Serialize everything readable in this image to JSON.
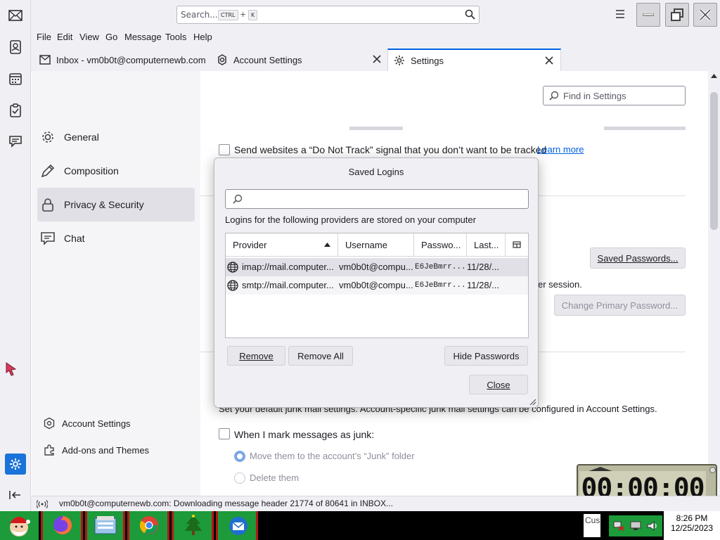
{
  "search": {
    "placeholder": "Search...",
    "key1": "CTRL",
    "plus": "+",
    "key2": "K"
  },
  "menu": [
    "File",
    "Edit",
    "View",
    "Go",
    "Message",
    "Tools",
    "Help"
  ],
  "tabs": [
    {
      "label": "Inbox - vm0b0t@computernewb.com"
    },
    {
      "label": "Account Settings"
    },
    {
      "label": "Settings"
    }
  ],
  "nav": {
    "items": [
      "General",
      "Composition",
      "Privacy & Security",
      "Chat"
    ],
    "bottom": [
      "Account Settings",
      "Add-ons and Themes"
    ]
  },
  "content": {
    "find_placeholder": "Find in Settings",
    "dnt_label": "Send websites a “Do Not Track” signal that you don’t want to be tracked",
    "learn_more": "Learn more",
    "saved_passwords_button": "Saved Passwords...",
    "session_text": "er session.",
    "change_primary_password": "Change Primary Password...",
    "junk_text": "Set your default junk mail settings. Account-specific junk mail settings can be configured in Account Settings.",
    "junk_checkbox": "When I mark messages as junk:",
    "move_option": "Move them to the account’s “Junk” folder",
    "delete_option": "Delete them"
  },
  "dialog": {
    "title": "Saved Logins",
    "search_value": "",
    "description": "Logins for the following providers are stored on your computer",
    "columns": [
      "Provider",
      "Username",
      "Passwo...",
      "Last..."
    ],
    "rows": [
      {
        "provider": "imap://mail.computer...",
        "username": "vm0b0t@compu...",
        "password": "E6JeBmrr...",
        "last": "11/28/..."
      },
      {
        "provider": "smtp://mail.computer...",
        "username": "vm0b0t@compu...",
        "password": "E6JeBmrr...",
        "last": "11/28/..."
      }
    ],
    "buttons": {
      "remove": "Remove",
      "remove_all": "Remove All",
      "hide_passwords": "Hide Passwords",
      "close": "Close"
    }
  },
  "statusbar": {
    "text": "vm0b0t@computernewb.com: Downloading message header 21774 of 80641 in INBOX..."
  },
  "timer": {
    "value": "00:00:00"
  },
  "taskbar": {
    "time": "8:26 PM",
    "date": "12/25/2023",
    "cus": "Cus"
  },
  "colors": {
    "accent": "#0061e0",
    "link": "#0061e0",
    "taskbar_green": "#1d9a3a"
  }
}
